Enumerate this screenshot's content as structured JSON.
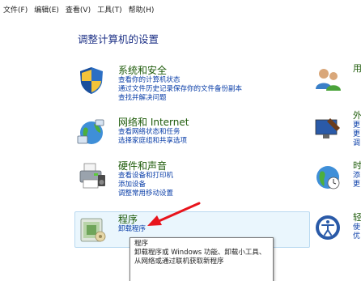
{
  "menu": [
    "文件(F)",
    "编辑(E)",
    "查看(V)",
    "工具(T)",
    "帮助(H)"
  ],
  "page_title": "调整计算机的设置",
  "categories": {
    "security": {
      "title": "系统和安全",
      "links": [
        "查看你的计算机状态",
        "通过文件历史记录保存你的文件备份副本",
        "查找并解决问题"
      ]
    },
    "network": {
      "title": "网络和 Internet",
      "links": [
        "查看网络状态和任务",
        "选择家庭组和共享选项"
      ]
    },
    "hardware": {
      "title": "硬件和声音",
      "links": [
        "查看设备和打印机",
        "添加设备",
        "调整常用移动设置"
      ]
    },
    "programs": {
      "title": "程序",
      "links": [
        "卸载程序"
      ]
    }
  },
  "tooltip": {
    "title": "程序",
    "body": "卸载程序或 Windows 功能、卸载小工具、从网络或通过联机获取新程序"
  },
  "right_column": {
    "user_accounts": {
      "title": "用",
      "links": [
        ""
      ]
    },
    "appearance": {
      "title": "外",
      "links": [
        "更",
        "更",
        "调"
      ]
    },
    "clock": {
      "title": "时",
      "links": [
        "添",
        "更"
      ]
    },
    "ease": {
      "title": "轻",
      "links": [
        "使",
        "优"
      ]
    }
  },
  "colors": {
    "title_blue": "#1e3287",
    "category_green": "#1e5b0a",
    "link_blue": "#0a3ea8",
    "hover_bg": "#eaf6fd",
    "arrow_red": "#e8141c"
  }
}
